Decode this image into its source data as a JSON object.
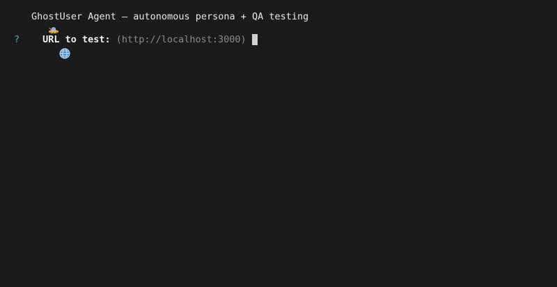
{
  "window": {
    "background": "#1b1b1b"
  },
  "header": {
    "icon": "flying-saucer-icon",
    "title": "GhostUser Agent — autonomous persona + QA testing"
  },
  "prompt": {
    "marker": "?",
    "icon": "globe-icon",
    "label": "URL to test:",
    "default_value": "(http://localhost:3000)",
    "input_value": "",
    "colors": {
      "marker": "#4aa8d8",
      "default": "#8a8a8a"
    }
  }
}
